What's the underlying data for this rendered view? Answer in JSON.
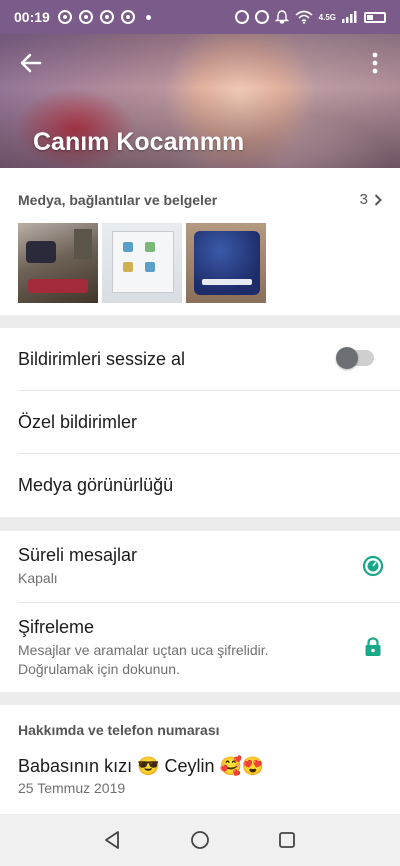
{
  "status_bar": {
    "time": "00:19",
    "network": "4.5G",
    "icons": [
      "chrome-icon",
      "chrome-icon",
      "chrome-icon",
      "chrome-icon",
      "alarm-icon",
      "data-saver-icon",
      "bell-icon",
      "wifi-icon",
      "signal-icon",
      "battery-icon"
    ]
  },
  "header": {
    "contact_name": "Canım Kocammm",
    "back_icon": "arrow-left-icon",
    "menu_icon": "more-vert-icon"
  },
  "media": {
    "heading": "Medya, bağlantılar ve belgeler",
    "count": "3",
    "thumbnails": [
      "photo-room",
      "photo-screen",
      "photo-router"
    ]
  },
  "settings": {
    "mute_label": "Bildirimleri sessize al",
    "mute_on": false,
    "custom_notifications_label": "Özel bildirimler",
    "media_visibility_label": "Medya görünürlüğü"
  },
  "privacy": {
    "disappearing_title": "Süreli mesajlar",
    "disappearing_status": "Kapalı",
    "encryption_title": "Şifreleme",
    "encryption_line1": "Mesajlar ve aramalar uçtan uca şifrelidir.",
    "encryption_line2": "Doğrulamak için dokunun.",
    "accent_color": "#1aa88a"
  },
  "about": {
    "heading": "Hakkımda ve telefon numarası",
    "text": "Babasının kızı 😎 Ceylin 🥰😍",
    "date": "25 Temmuz 2019"
  },
  "nav": {
    "back": "triangle-back-icon",
    "home": "circle-home-icon",
    "recents": "square-recents-icon"
  }
}
